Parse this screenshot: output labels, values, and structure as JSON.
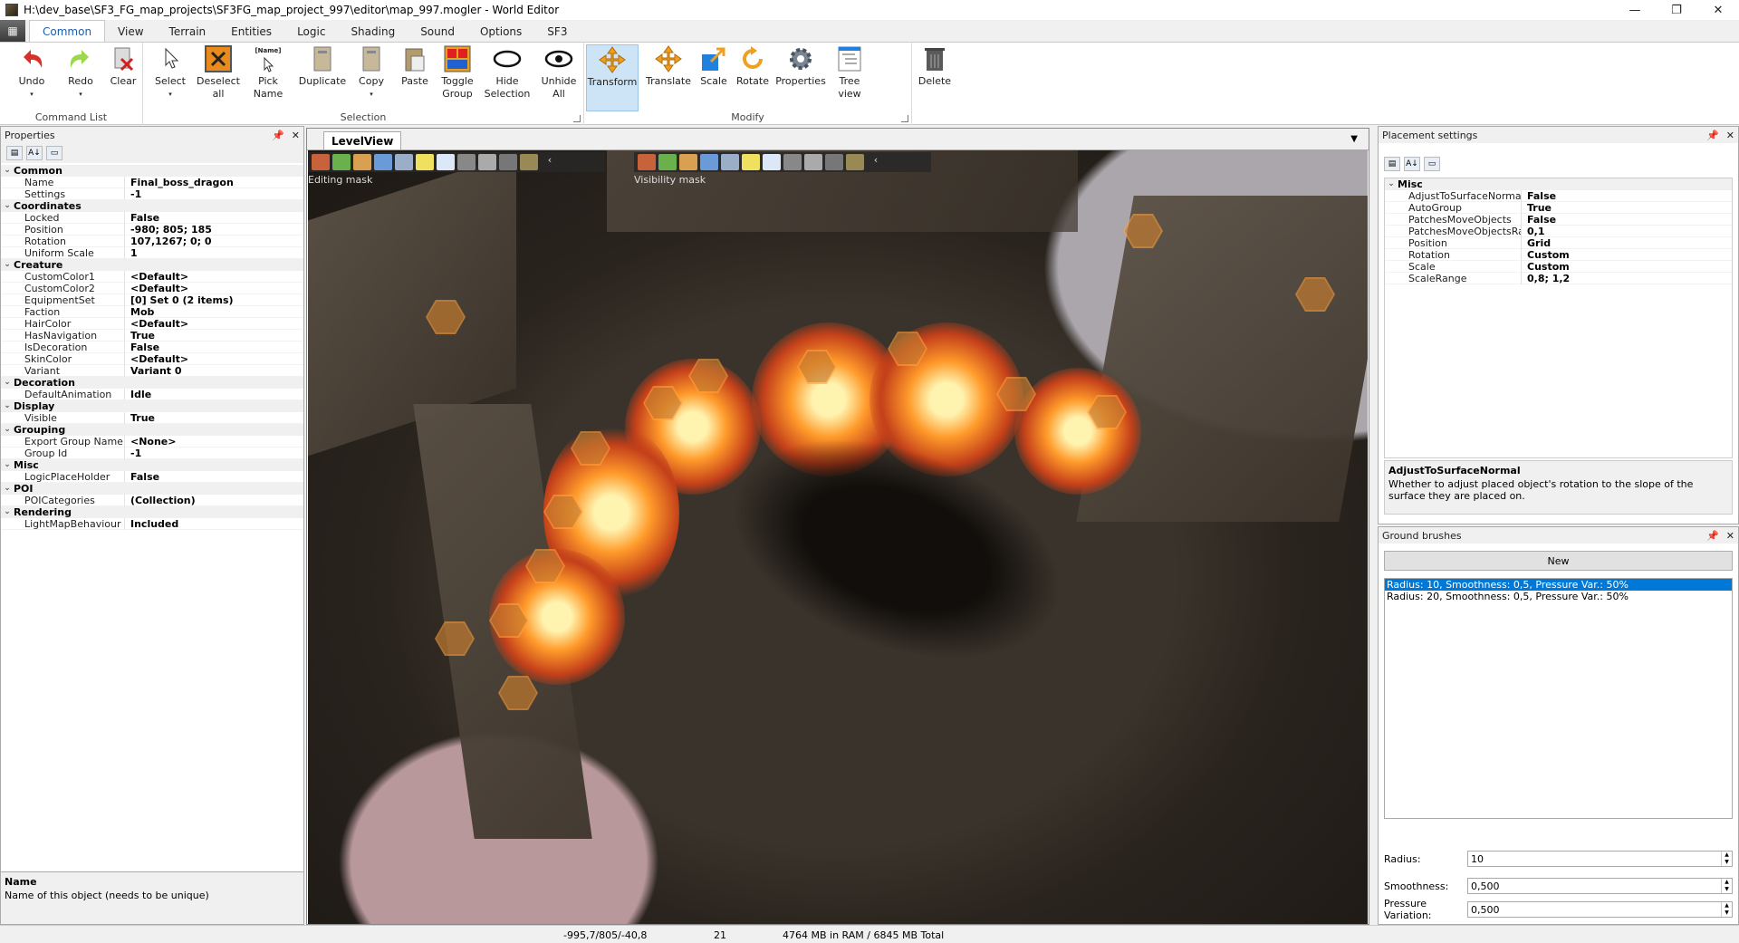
{
  "window": {
    "title": "H:\\dev_base\\SF3_FG_map_projects\\SF3FG_map_project_997\\editor\\map_997.mogler - World Editor",
    "minimize": "—",
    "maximize": "❐",
    "close": "✕"
  },
  "ribbon_tabs": [
    "Common",
    "View",
    "Terrain",
    "Entities",
    "Logic",
    "Shading",
    "Sound",
    "Options",
    "SF3"
  ],
  "ribbon": {
    "groups": {
      "command_list": "Command List",
      "selection": "Selection",
      "modify": "Modify"
    },
    "buttons": {
      "undo": "Undo",
      "redo": "Redo",
      "clear": "Clear",
      "select": "Select",
      "deselect_all": "Deselect all",
      "pick_name": "Pick Name",
      "pick_name_tag": "[Name]",
      "duplicate": "Duplicate",
      "copy": "Copy",
      "paste": "Paste",
      "toggle_group": "Toggle Group",
      "hide_selection": "Hide Selection",
      "unhide_all": "Unhide All",
      "transform": "Transform",
      "translate": "Translate",
      "scale": "Scale",
      "rotate": "Rotate",
      "properties": "Properties",
      "tree_view": "Tree view",
      "delete": "Delete"
    }
  },
  "properties_panel": {
    "title": "Properties",
    "sections": [
      {
        "name": "Common",
        "rows": [
          [
            "Name",
            "Final_boss_dragon"
          ],
          [
            "Settings",
            "-1"
          ]
        ]
      },
      {
        "name": "Coordinates",
        "rows": [
          [
            "Locked",
            "False"
          ],
          [
            "Position",
            "-980; 805; 185"
          ],
          [
            "Rotation",
            "107,1267; 0; 0"
          ],
          [
            "Uniform Scale",
            "1"
          ]
        ]
      },
      {
        "name": "Creature",
        "rows": [
          [
            "CustomColor1",
            "<Default>"
          ],
          [
            "CustomColor2",
            "<Default>"
          ],
          [
            "EquipmentSet",
            "[0] Set 0 (2 items)"
          ],
          [
            "Faction",
            "Mob"
          ],
          [
            "HairColor",
            "<Default>"
          ],
          [
            "HasNavigation",
            "True"
          ],
          [
            "IsDecoration",
            "False"
          ],
          [
            "SkinColor",
            "<Default>"
          ],
          [
            "Variant",
            "Variant 0"
          ]
        ]
      },
      {
        "name": "Decoration",
        "rows": [
          [
            "DefaultAnimation",
            "Idle"
          ]
        ]
      },
      {
        "name": "Display",
        "rows": [
          [
            "Visible",
            "True"
          ]
        ]
      },
      {
        "name": "Grouping",
        "rows": [
          [
            "Export Group Name",
            "<None>"
          ],
          [
            "Group Id",
            "-1"
          ]
        ]
      },
      {
        "name": "Misc",
        "rows": [
          [
            "LogicPlaceHolder",
            "False"
          ]
        ]
      },
      {
        "name": "POI",
        "rows": [
          [
            "POICategories",
            "(Collection)"
          ]
        ]
      },
      {
        "name": "Rendering",
        "rows": [
          [
            "LightMapBehaviour",
            "Included"
          ]
        ]
      }
    ],
    "desc_title": "Name",
    "desc_text": "Name of this object (needs to be unique)"
  },
  "levelview": {
    "tab": "LevelView",
    "editing_mask": "Editing mask",
    "visibility_mask": "Visibility mask"
  },
  "placement_panel": {
    "title": "Placement settings",
    "section": "Misc",
    "rows": [
      [
        "AdjustToSurfaceNormal",
        "False"
      ],
      [
        "AutoGroup",
        "True"
      ],
      [
        "PatchesMoveObjects",
        "False"
      ],
      [
        "PatchesMoveObjectsRange",
        "0,1"
      ],
      [
        "Position",
        "Grid"
      ],
      [
        "Rotation",
        "Custom"
      ],
      [
        "Scale",
        "Custom"
      ],
      [
        "ScaleRange",
        "0,8; 1,2"
      ]
    ],
    "desc_title": "AdjustToSurfaceNormal",
    "desc_text": "Whether to adjust placed object's rotation to the slope of the surface they are placed on."
  },
  "ground_brushes": {
    "title": "Ground brushes",
    "new_button": "New",
    "items": [
      "Radius: 10, Smoothness: 0,5, Pressure Var.: 50%",
      "Radius: 20, Smoothness: 0,5, Pressure Var.: 50%"
    ],
    "radius_label": "Radius:",
    "radius_value": "10",
    "smoothness_label": "Smoothness:",
    "smoothness_value": "0,500",
    "pressure_label": "Pressure Variation:",
    "pressure_value": "0,500"
  },
  "status": {
    "coords": "-995,7/805/-40,8",
    "count": "21",
    "memory": "4764 MB in RAM / 6845 MB Total"
  },
  "colors": {
    "accent": "#1b5eaa",
    "selection": "#0078d7",
    "transform_selected": "#cde4f7"
  }
}
